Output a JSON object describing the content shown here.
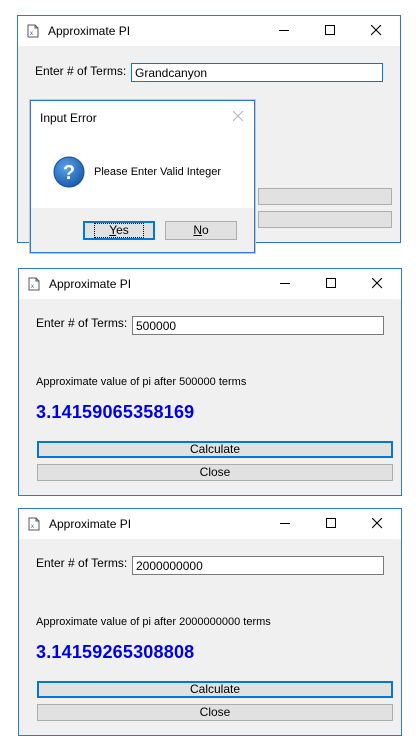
{
  "windows": [
    {
      "title": "Approximate PI",
      "terms_label": "Enter # of Terms:",
      "terms_value": "Grandcanyon",
      "result_label": "",
      "result_value": "",
      "calculate_label": "",
      "close_label": ""
    },
    {
      "title": "Approximate PI",
      "terms_label": "Enter # of Terms:",
      "terms_value": "500000",
      "result_label": "Approximate value of pi after 500000 terms",
      "result_value": "3.14159065358169",
      "calculate_label": "Calculate",
      "close_label": "Close"
    },
    {
      "title": "Approximate PI",
      "terms_label": "Enter # of Terms:",
      "terms_value": "2000000000",
      "result_label": "Approximate value of pi after 2000000000 terms",
      "result_value": "3.14159265308808",
      "calculate_label": "Calculate",
      "close_label": "Close"
    }
  ],
  "dialog": {
    "title": "Input Error",
    "message": "Please Enter Valid Integer",
    "yes_label": "Yes",
    "yes_mnemonic": "Y",
    "yes_rest": "es",
    "no_label": "No",
    "no_mnemonic": "N",
    "no_rest": "o",
    "icon": "question-icon"
  },
  "colors": {
    "accent": "#0078d7",
    "window_border": "#2b79d0",
    "result_text": "#0000e6",
    "window_bg": "#f0f0f0"
  }
}
